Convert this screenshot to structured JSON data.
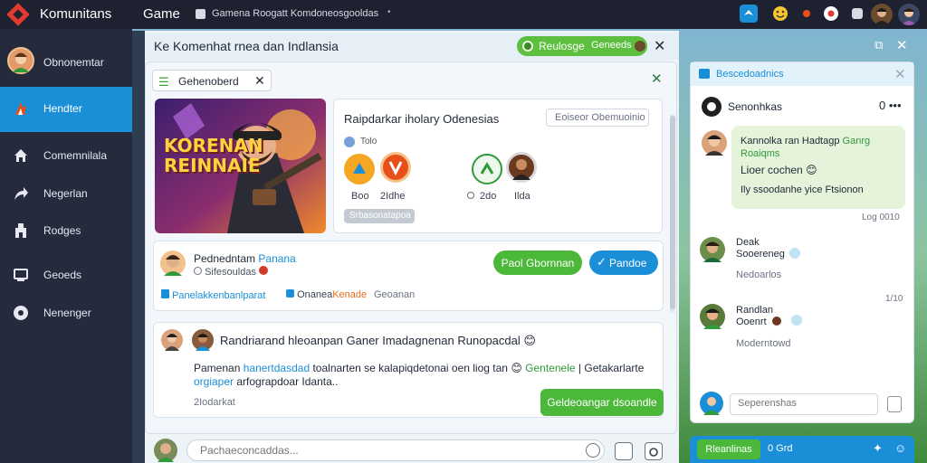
{
  "app": {
    "name": "Komunitans",
    "section": "Game",
    "breadcrumb": "Gamena Roogatt Komdoneosgooldas",
    "breadcrumb_dot": "•"
  },
  "sidebar": {
    "profile_label": "Obnonemtar",
    "items": [
      {
        "label": "Hendter",
        "icon": "flame-icon",
        "active": true
      },
      {
        "label": "Comemnilala",
        "icon": "home-icon",
        "active": false
      },
      {
        "label": "Negerlan",
        "icon": "share-icon",
        "active": false
      },
      {
        "label": "Rodges",
        "icon": "building-icon",
        "active": false
      },
      {
        "label": "Geoeds",
        "icon": "monitor-icon",
        "active": false
      },
      {
        "label": "Nenenger",
        "icon": "compass-icon",
        "active": false
      }
    ]
  },
  "main": {
    "title": "Ke Komenhat rnea dan Indlansia",
    "pill_left": "Reulosge",
    "pill_right": "Geneeds",
    "close": "✕",
    "tab_label": "Gehenoberd",
    "tab_close": "✕",
    "panel_close": "✕",
    "game_art_title_1": "KORENAN",
    "game_art_title_2": "REINNAIE",
    "card_a": {
      "title": "Raipdarkar iholary Odenesias",
      "search_placeholder": "Eoiseor Obemuoinio",
      "sub": "Tolo",
      "players": [
        {
          "label": "Boo",
          "color": "#f5a623"
        },
        {
          "label": "2Idhe",
          "color": "#e8501a"
        },
        {
          "label": "2do",
          "color": "#2f9a3a"
        },
        {
          "label": "Ilda",
          "color": "#6b3a1e"
        }
      ],
      "chip": "Srbasonatapoa"
    },
    "card_b": {
      "name": "Pednedntam",
      "name_accent": "Panana",
      "sub": "Sifesouldas",
      "btn_green": "Paol Gbornnan",
      "btn_blue": "Pandoe",
      "btn_blue_check": "✓",
      "link1": "Panelakkenbanlparat",
      "link2_a": "Onanea",
      "link2_b": "Kenade",
      "link3": "Geoanan"
    },
    "card_c": {
      "title": "Randriarand hleoanpan Ganer Imadagnenan Runopacdal",
      "title_emoji": "😊",
      "text_a": "Pamenan",
      "text_b": "hanertdasdad",
      "text_c": "toalnarten se kalapiqdetonai oen liog tan",
      "text_emoji": "😊",
      "text_d": "Gentenele",
      "text_e": "| Getakarlarte",
      "text_f": "orgiaper",
      "text_g": "arfograpdoar Idanta..",
      "meta": "2Iodarkat",
      "btn": "Geldeoangar dsoandle"
    },
    "chat_placeholder": "Pachaeconcaddas..."
  },
  "chat": {
    "window_controls": [
      "⧉",
      "✕"
    ],
    "header": "Bescedoadnics",
    "header_close": "✕",
    "sub_title": "Senonhkas",
    "sub_more": "0 •••",
    "bubble": {
      "line1_a": "Kannolka ran Hadtagp",
      "line1_b": "Ganrg",
      "line1_c": "Roaiqms",
      "line2": "Lioer cochen",
      "line2_emoji": "😊",
      "line3": "Ily ssoodanhe yice Ftsionon"
    },
    "bubble_time": "Log 0010",
    "messages": [
      {
        "name": "Deak",
        "sub": "Sooereneg",
        "sub2": "Nedoarlos",
        "time": ""
      },
      {
        "name": "Randlan",
        "sub": "Ooenrt",
        "sub2": "Moderntowd",
        "time": "1/10"
      }
    ],
    "input_placeholder": "Seperenshas",
    "footer_tag": "Rleanlinas",
    "footer_text": "0 Grd"
  },
  "colors": {
    "accent_blue": "#1a8fd8",
    "accent_green": "#4bb83a",
    "topbar": "#1e2230",
    "sidebar": "#252a3d"
  }
}
